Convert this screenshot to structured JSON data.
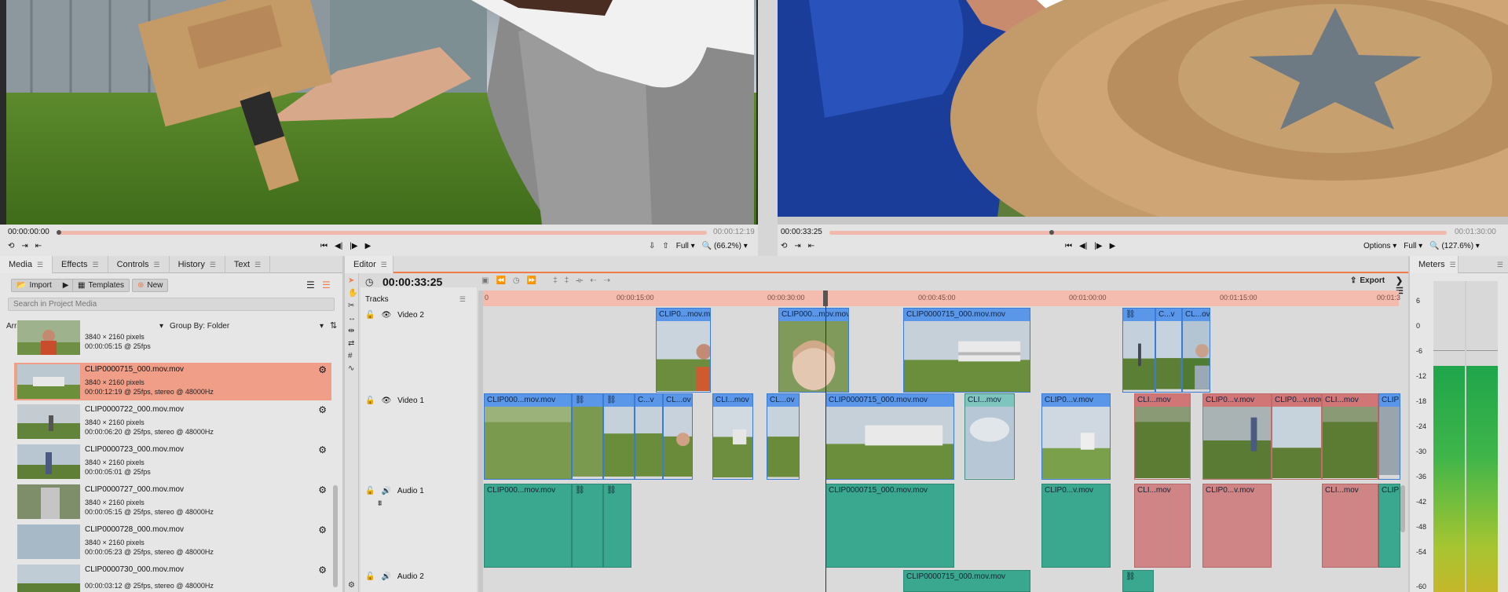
{
  "left_viewer": {
    "timecode": "00:00:00:00",
    "duration": "00:00:12:19",
    "quality": "Full",
    "zoom": "(66.2%)",
    "playhead_fraction": 0.0
  },
  "right_viewer": {
    "timecode": "00:00:33:25",
    "duration": "00:01:30:00",
    "options": "Options",
    "quality": "Full",
    "zoom": "(127.6%)",
    "playhead_fraction": 0.36
  },
  "tabs": [
    "Media",
    "Effects",
    "Controls",
    "History",
    "Text"
  ],
  "media_toolbar": {
    "import": "Import",
    "templates": "Templates",
    "new": "New"
  },
  "search_placeholder": "Search in Project Media",
  "arrange_label": "Arrange By: Name",
  "group_label": "Group By: Folder",
  "media_items": [
    {
      "name": "",
      "res": "3840 × 2160 pixels",
      "info": "00:00:05:15 @ 25fps"
    },
    {
      "name": "CLIP0000715_000.mov.mov",
      "res": "3840 × 2160 pixels",
      "info": "00:00:12:19 @ 25fps, stereo @ 48000Hz"
    },
    {
      "name": "CLIP0000722_000.mov.mov",
      "res": "3840 × 2160 pixels",
      "info": "00:00:06:20 @ 25fps, stereo @ 48000Hz"
    },
    {
      "name": "CLIP0000723_000.mov.mov",
      "res": "3840 × 2160 pixels",
      "info": "00:00:05:01 @ 25fps"
    },
    {
      "name": "CLIP0000727_000.mov.mov",
      "res": "3840 × 2160 pixels",
      "info": "00:00:05:15 @ 25fps, stereo @ 48000Hz"
    },
    {
      "name": "CLIP0000728_000.mov.mov",
      "res": "3840 × 2160 pixels",
      "info": "00:00:05:23 @ 25fps, stereo @ 48000Hz"
    },
    {
      "name": "CLIP0000730_000.mov.mov",
      "res": "",
      "info": "00:00:03:12 @ 25fps, stereo @ 48000Hz"
    }
  ],
  "editor": {
    "tab": "Editor",
    "timecode": "00:00:33:25",
    "export": "Export",
    "tracks_label": "Tracks",
    "ruler": [
      "0",
      "00:00:15:00",
      "00:00:30:00",
      "00:00:45:00",
      "00:01:00:00",
      "00:01:15:00",
      "00:01:3"
    ],
    "tracks": [
      "Video 2",
      "Video 1",
      "Audio 1",
      "Audio 2"
    ],
    "video2_clips": [
      "CLIP0...mov.mov",
      "CLIP000...mov.mov",
      "CLIP0000715_000.mov.mov",
      "C...v",
      "CL...ov"
    ],
    "video1_clips": [
      "CLIP000...mov.mov",
      "C...v",
      "CL...ov",
      "CLI...mov",
      "CL...ov",
      "CLIP0000715_000.mov.mov",
      "CLI...mov",
      "CLIP0...v.mov",
      "CLI...mov",
      "CLIP0...v.mov",
      "CLIP0...v.mov",
      "CLI...mov",
      "CLIP"
    ],
    "audio1_clips": [
      "CLIP000...mov.mov",
      "CLIP0000715_000.mov.mov",
      "CLIP0...v.mov",
      "CLI...mov",
      "CLIP0...v.mov",
      "CLI...mov",
      "CLIP"
    ],
    "audio2_clips": [
      "CLIP0000715_000.mov.mov"
    ]
  },
  "meters": {
    "tab": "Meters",
    "top_labels": [
      "-6",
      "-6"
    ],
    "scale": [
      "6",
      "0",
      "-6",
      "-12",
      "-18",
      "-24",
      "-30",
      "-36",
      "-42",
      "-48",
      "-54",
      "-60"
    ]
  },
  "colors": {
    "selection": "#f19e88",
    "accent": "#f07c4a",
    "video_clip": "#5b97e8",
    "audio_clip": "#3aa88e",
    "red_clip": "#d07676"
  }
}
